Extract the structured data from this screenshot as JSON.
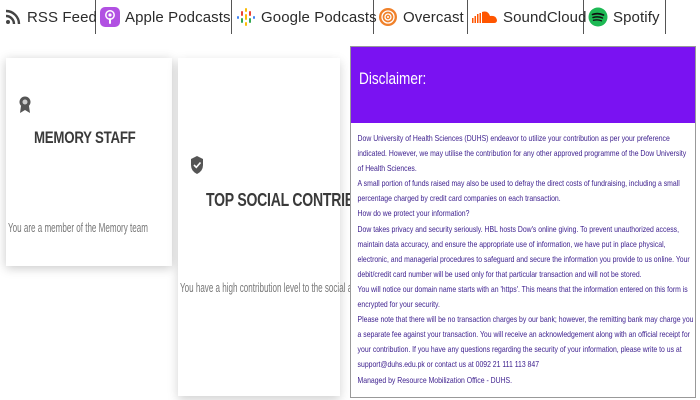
{
  "podcast_bar": {
    "links": [
      {
        "label": "RSS Feed",
        "icon": "rss-icon",
        "color": "#333333"
      },
      {
        "label": "Apple Podcasts",
        "icon": "apple-podcasts-icon",
        "color": "#a347d6"
      },
      {
        "label": "Google Podcasts",
        "icon": "google-podcasts-icon",
        "color": "#4285f4"
      },
      {
        "label": "Overcast",
        "icon": "overcast-icon",
        "color": "#f0812a"
      },
      {
        "label": "SoundCloud",
        "icon": "soundcloud-icon",
        "color": "#ff5500"
      },
      {
        "label": "Spotify",
        "icon": "spotify-icon",
        "color": "#1db954"
      }
    ]
  },
  "cards": [
    {
      "title": "MEMORY STAFF",
      "text": "You are a member of the Memory team",
      "icon": "medal-icon"
    },
    {
      "title": "TOP SOCIAL CONTRIBUTOR",
      "text": "You have a high contribution level to the social aspects",
      "icon": "shield-check-icon"
    }
  ],
  "disclaimer": {
    "title": "Disclaimer:",
    "accent": "#7a12f2",
    "paragraphs": [
      "Dow University of Health Sciences (DUHS) endeavor to utilize your contribution as per your preference indicated. However, we may utilise the contribution for any other approved programme of the Dow University of Health Sciences.",
      "A small portion of funds raised may also be used to defray the direct costs of fundraising, including a small percentage charged by credit card companies on each transaction.",
      "How do we protect your information?",
      "Dow takes privacy and security seriously. HBL hosts Dow's online giving. To prevent unauthorized access, maintain data accuracy, and ensure the appropriate use of information, we have put in place physical, electronic, and managerial procedures to safeguard and secure the information you provide to us online. Your debit/credit card number will be used only for that particular transaction and will not be stored.",
      "You will notice our domain name starts with an 'https'. This means that the information entered on this form is encrypted for your security.",
      "Please note that there will be no transaction charges by our bank; however, the remitting bank may charge you a separate fee against your transaction. You will receive an acknowledgement along with an official receipt for your contribution. If you have any questions regarding the security of your information, please write to us at support@duhs.edu.pk or contact us at 0092 21 111 113 847",
      "Managed by Resource Mobilization Office - DUHS."
    ]
  }
}
